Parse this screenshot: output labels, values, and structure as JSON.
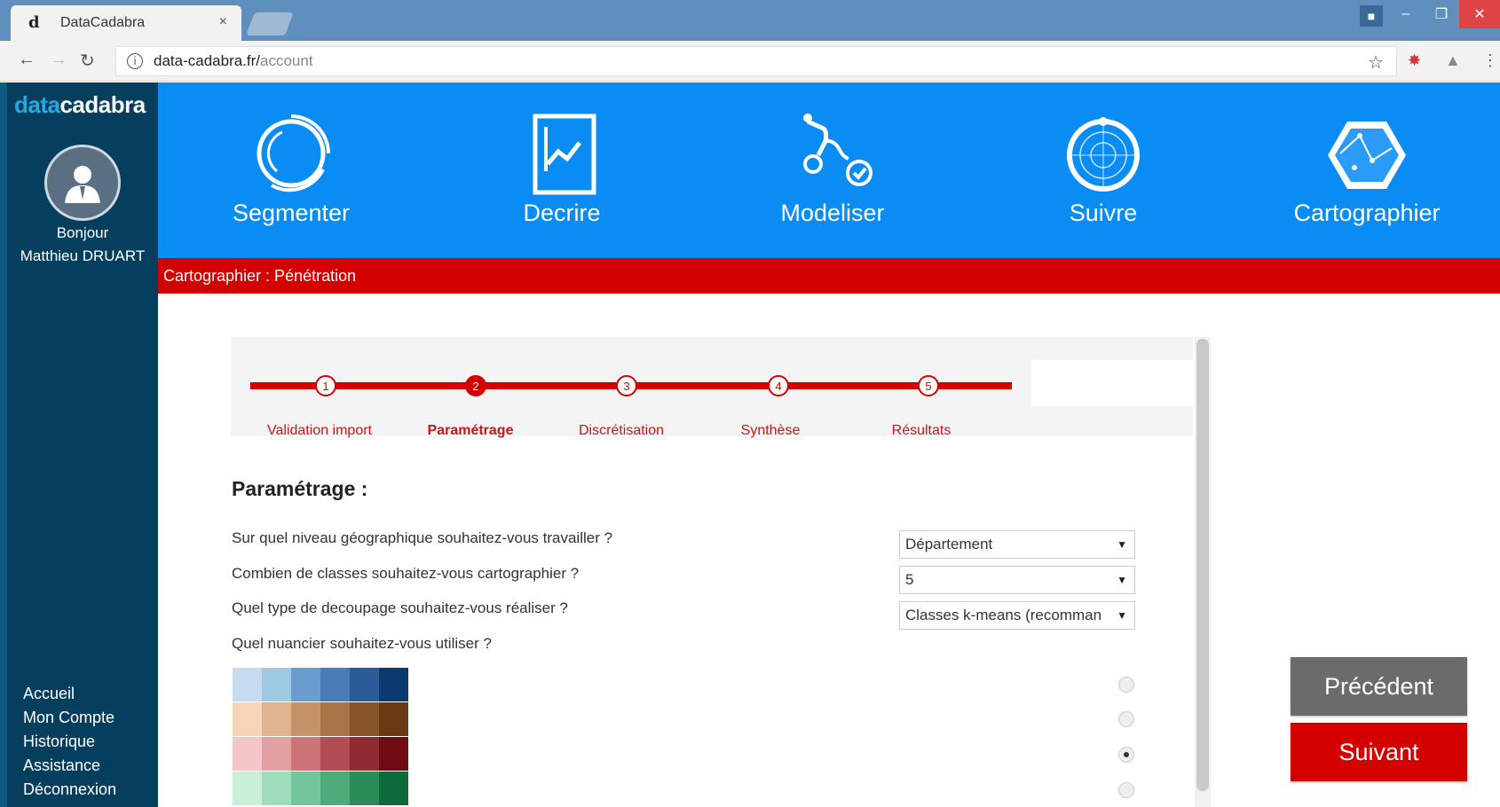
{
  "browser": {
    "tab_title": "DataCadabra",
    "tab_close": "×",
    "favicon_letter": "d",
    "url_host": "data-cadabra.fr/",
    "url_path": "account"
  },
  "sidebar": {
    "logo_part1": "data",
    "logo_part2": "cadabra",
    "greeting": "Bonjour",
    "user_name": "Matthieu DRUART",
    "links": [
      "Accueil",
      "Mon Compte",
      "Historique",
      "Assistance",
      "Déconnexion"
    ]
  },
  "modules": [
    "Segmenter",
    "Decrire",
    "Modeliser",
    "Suivre",
    "Cartographier"
  ],
  "breadcrumb": "Cartographier : Pénétration",
  "steps": {
    "numbers": [
      "1",
      "2",
      "3",
      "4",
      "5"
    ],
    "labels": [
      "Validation import",
      "Paramétrage",
      "Discrétisation",
      "Synthèse",
      "Résultats"
    ],
    "active_index": 1
  },
  "form": {
    "title": "Paramétrage :",
    "questions": [
      "Sur quel niveau géographique souhaitez-vous travailler ?",
      "Combien de classes souhaitez-vous cartographier ?",
      "Quel type de decoupage souhaitez-vous réaliser ?",
      "Quel nuancier souhaitez-vous utiliser ?"
    ],
    "selects": [
      "Département",
      "5",
      "Classes k-means (recomman"
    ],
    "palettes": [
      [
        "#c6dbef",
        "#9ecae1",
        "#6b9ccf",
        "#4a7cb8",
        "#2c5b9a",
        "#0b3a73"
      ],
      [
        "#f6d5b8",
        "#dfb48f",
        "#c49468",
        "#a67446",
        "#88552b",
        "#6a3a14"
      ],
      [
        "#f4c6c6",
        "#e3a0a3",
        "#cc7478",
        "#b24d53",
        "#922a31",
        "#6e0c12"
      ],
      [
        "#c7efd9",
        "#9edcbc",
        "#73c69a",
        "#4cab78",
        "#2a8c58",
        "#0c6b3b"
      ]
    ],
    "palette_checked_index": 2
  },
  "buttons": {
    "prev": "Précédent",
    "next": "Suivant"
  },
  "colors": {
    "header_blue": "#0a8cf5",
    "sidebar_navy": "#063f5e",
    "accent_red": "#d40000"
  }
}
